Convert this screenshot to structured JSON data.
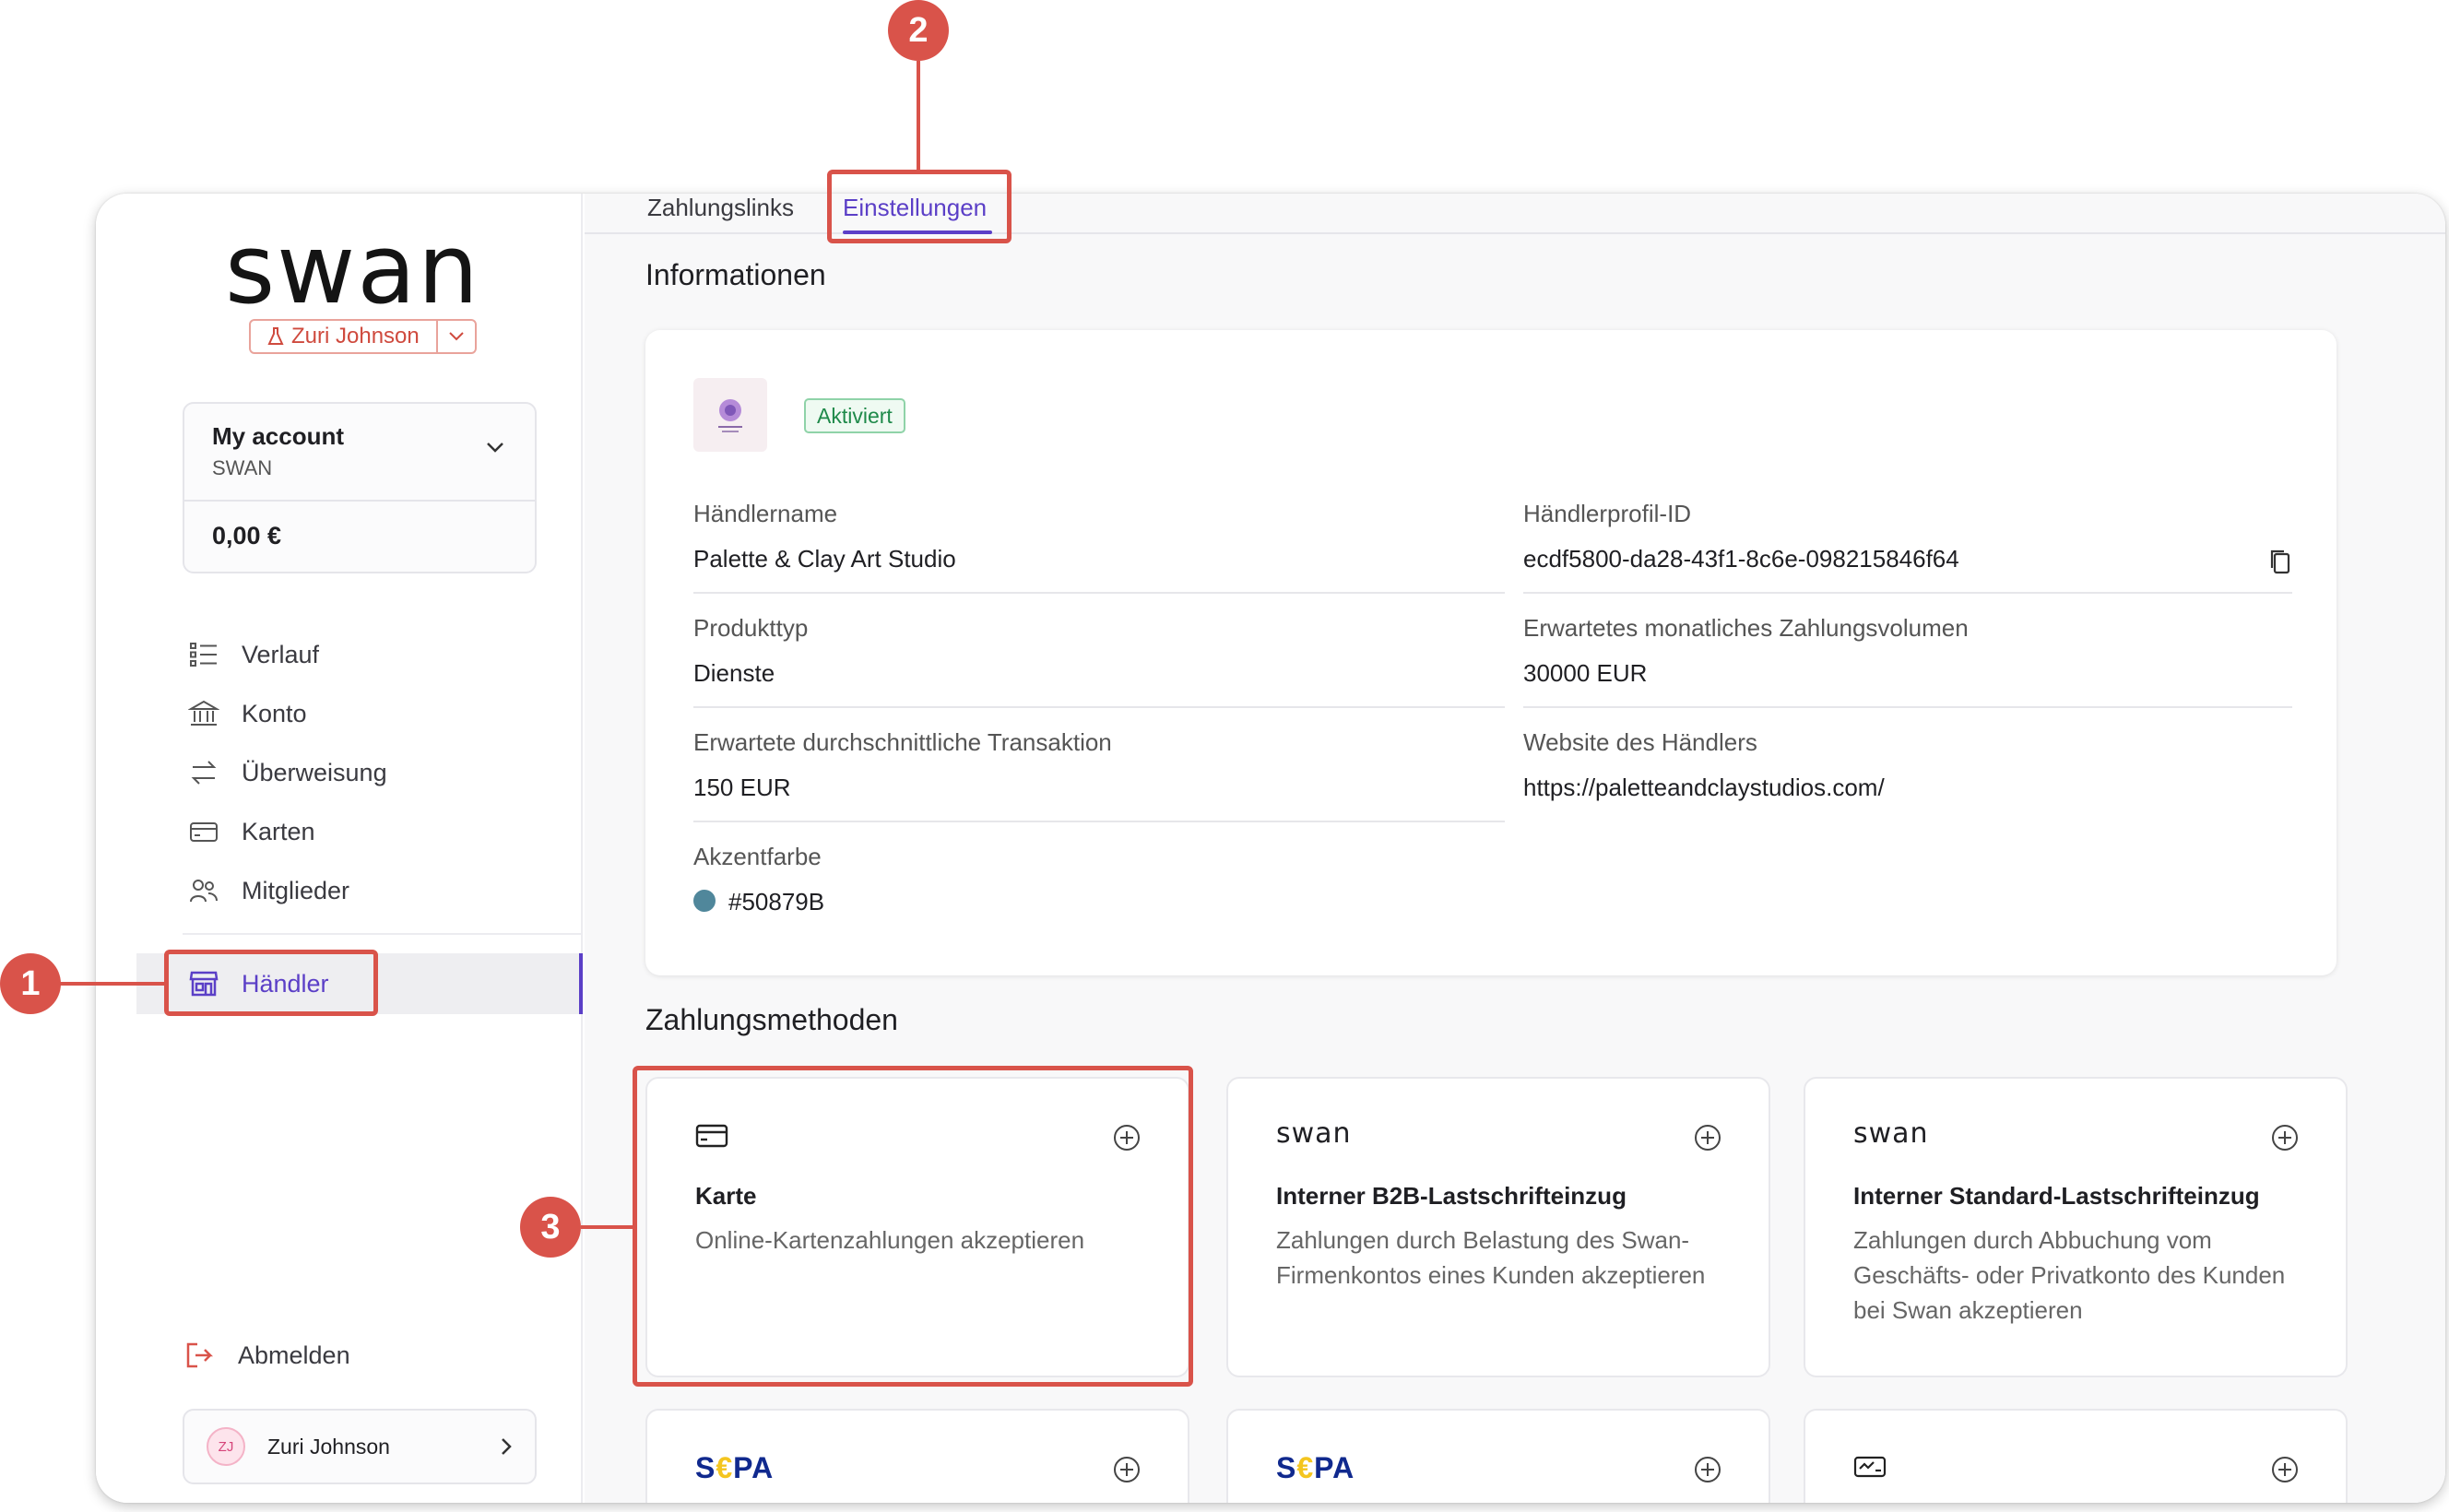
{
  "sidebar": {
    "logo_text": "swan",
    "project": {
      "name": "Zuri Johnson"
    },
    "account": {
      "name": "My account",
      "sub": "SWAN",
      "balance": "0,00 €"
    },
    "nav": [
      {
        "label": "Verlauf",
        "icon": "list-icon"
      },
      {
        "label": "Konto",
        "icon": "bank-icon"
      },
      {
        "label": "Überweisung",
        "icon": "transfer-icon"
      },
      {
        "label": "Karten",
        "icon": "card-icon"
      },
      {
        "label": "Mitglieder",
        "icon": "members-icon"
      }
    ],
    "active_item": {
      "label": "Händler",
      "icon": "store-icon"
    },
    "logout_label": "Abmelden",
    "user": {
      "initials": "ZJ",
      "name": "Zuri Johnson"
    }
  },
  "tabs": [
    {
      "label": "Zahlungslinks",
      "active": false
    },
    {
      "label": "Einstellungen",
      "active": true
    }
  ],
  "info": {
    "section_title": "Informationen",
    "status": "Aktiviert",
    "fields": {
      "merchant_name": {
        "label": "Händlername",
        "value": "Palette & Clay Art Studio"
      },
      "profile_id": {
        "label": "Händlerprofil-ID",
        "value": "ecdf5800-da28-43f1-8c6e-098215846f64"
      },
      "product_type": {
        "label": "Produkttyp",
        "value": "Dienste"
      },
      "monthly_volume": {
        "label": "Erwartetes monatliches Zahlungsvolumen",
        "value": "30000 EUR"
      },
      "avg_transaction": {
        "label": "Erwartete durchschnittliche Transaktion",
        "value": "150 EUR"
      },
      "website": {
        "label": "Website des Händlers",
        "value": "https://paletteandclaystudios.com/"
      },
      "accent_color": {
        "label": "Akzentfarbe",
        "value": "#50879B"
      }
    }
  },
  "payment_methods": {
    "section_title": "Zahlungsmethoden",
    "cards": [
      {
        "logo": "card-icon",
        "title": "Karte",
        "desc": "Online-Kartenzahlungen akzeptieren"
      },
      {
        "logo_text": "swan",
        "title": "Interner B2B-Lastschrifteinzug",
        "desc": "Zahlungen durch Belastung des Swan-Firmenkontos eines Kunden akzeptieren"
      },
      {
        "logo_text": "swan",
        "title": "Interner Standard-Lastschrifteinzug",
        "desc": "Zahlungen durch Abbuchung vom Geschäfts- oder Privatkonto des Kunden bei Swan akzeptieren"
      }
    ],
    "bottom_cards": [
      {
        "logo_text": "S€PA"
      },
      {
        "logo_text": "S€PA"
      },
      {
        "logo": "check-card-icon"
      }
    ]
  },
  "annotations": [
    "1",
    "2",
    "3"
  ],
  "colors": {
    "accent": "#5b3fc7",
    "annotation": "#d9534a",
    "merchant_accent": "#50879B"
  }
}
